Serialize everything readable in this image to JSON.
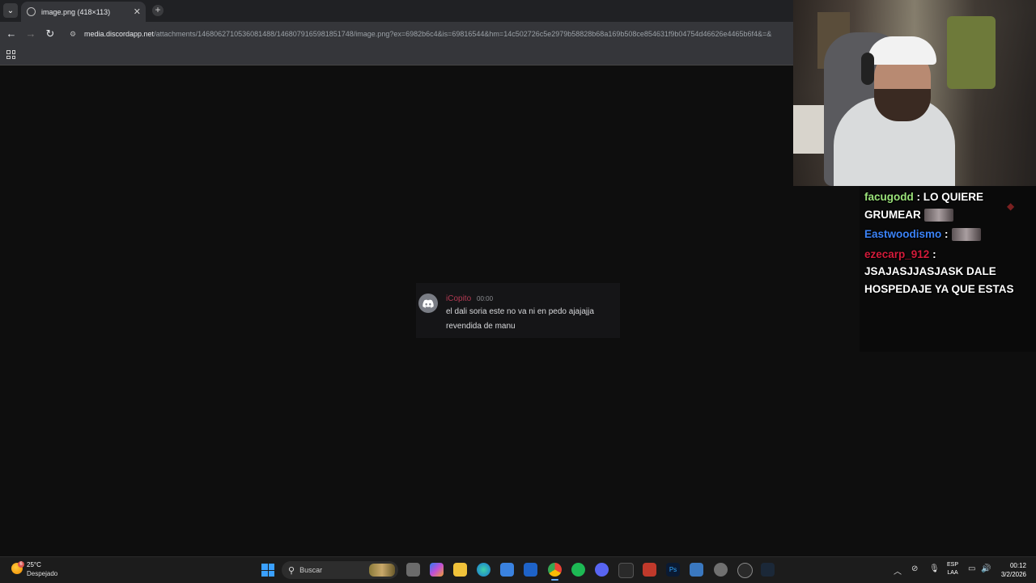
{
  "browser": {
    "tab_title": "image.png (418×113)",
    "tab_close": "✕",
    "new_tab": "+",
    "url_host": "media.discordapp.net",
    "url_path": "/attachments/1468062710536081488/1468079165981851748/image.png?ex=6982b6c4&is=69816544&hm=14c502726c5e2979b58828b68a169b508ce854631f9b04754d46626e4465b6f4&=&"
  },
  "discord_message": {
    "author": "iCopito",
    "time": "00:00",
    "text": "el dali soria este no va ni en pedo ajajajja revendida de manu",
    "author_color": "#b23a52"
  },
  "chat": {
    "messages": [
      {
        "user": "facugodd",
        "user_color": "#9be37a",
        "text": "LO QUIERE",
        "continuation": "GRUMEAR"
      },
      {
        "user": "Eastwoodismo",
        "user_color": "#3b82f6",
        "text": ""
      },
      {
        "user": "ezecarp_912",
        "user_color": "#d31b3a",
        "text": "",
        "continuation": "JSAJASJJASJASK DALE",
        "continuation2": "HOSPEDAJE YA QUE ESTAS"
      }
    ],
    "separator": " :"
  },
  "taskbar": {
    "weather_temp": "25°C",
    "weather_desc": "Despejado",
    "weather_badge": "6",
    "search_placeholder": "Buscar",
    "lang_line1": "ESP",
    "lang_line2": "LAA",
    "time": "00:12",
    "date": "3/2/2026"
  }
}
